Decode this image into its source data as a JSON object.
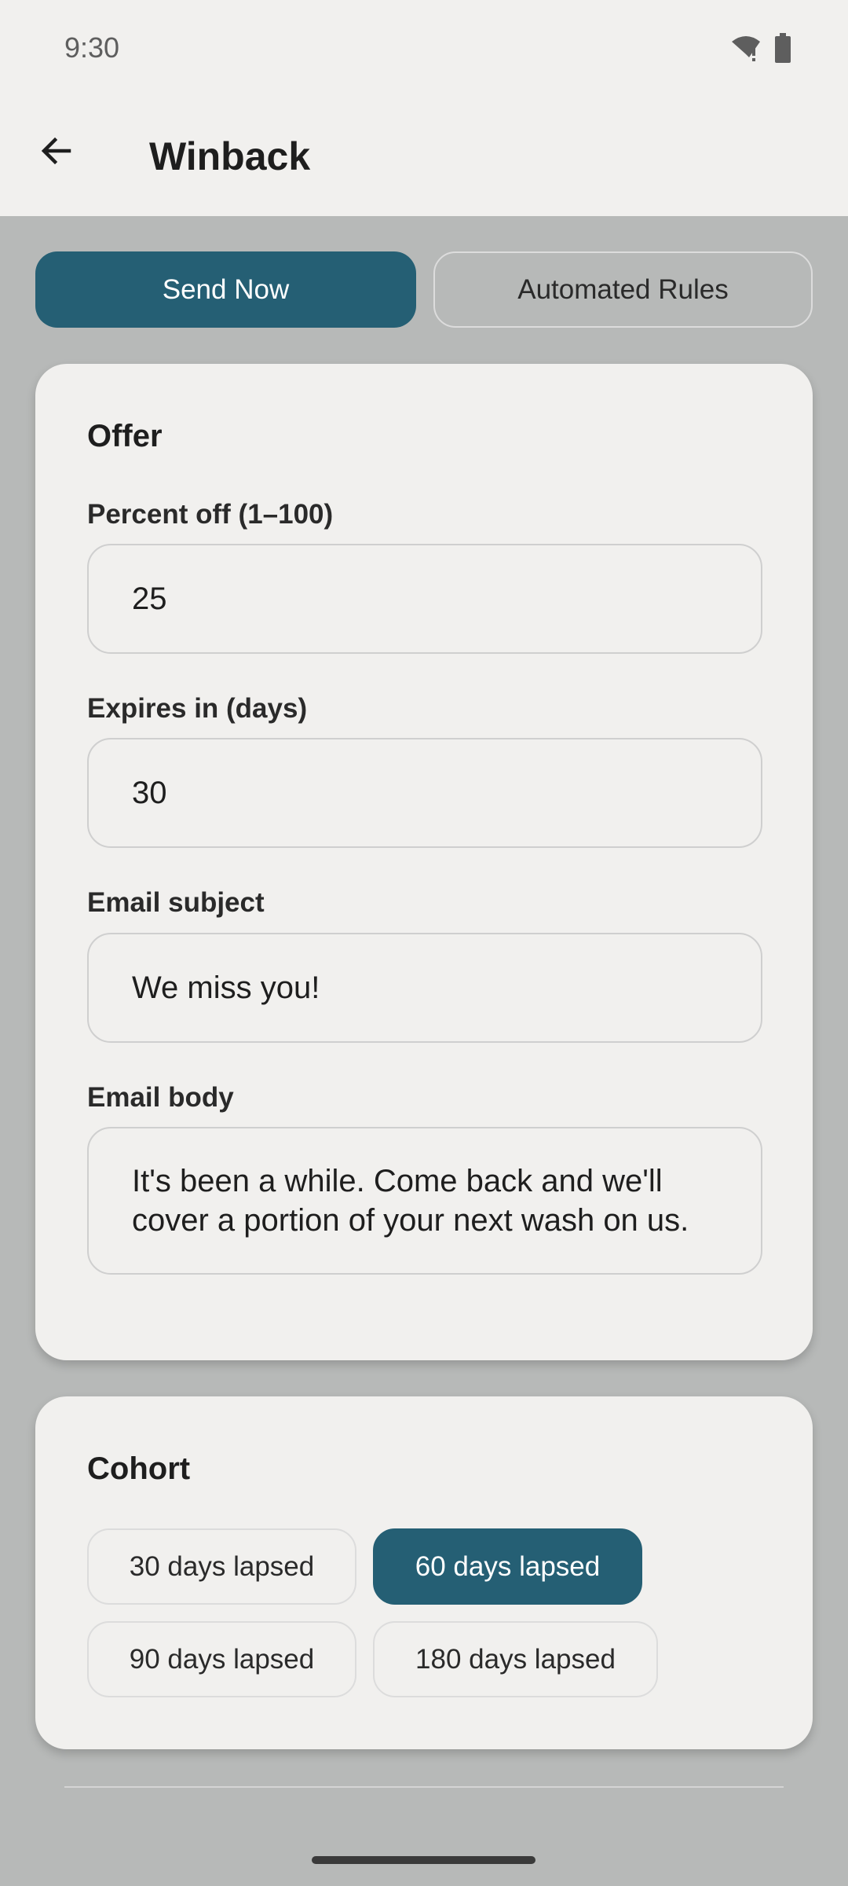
{
  "status_bar": {
    "time": "9:30",
    "icons": [
      "wifi-alert-icon",
      "battery-icon"
    ]
  },
  "app_bar": {
    "back_icon": "arrow-left-icon",
    "title": "Winback"
  },
  "tabs": [
    {
      "label": "Send Now",
      "selected": true
    },
    {
      "label": "Automated Rules",
      "selected": false
    }
  ],
  "offer": {
    "title": "Offer",
    "percent_label": "Percent off (1–100)",
    "percent_value": "25",
    "expires_label": "Expires in (days)",
    "expires_value": "30",
    "subject_label": "Email subject",
    "subject_value": "We miss you!",
    "body_label": "Email body",
    "body_value": "It's been a while. Come back and we'll cover a portion of your next wash on us."
  },
  "cohort": {
    "title": "Cohort",
    "options": [
      {
        "label": "30 days lapsed",
        "selected": false
      },
      {
        "label": "60 days lapsed",
        "selected": true
      },
      {
        "label": "90 days lapsed",
        "selected": false
      },
      {
        "label": "180 days lapsed",
        "selected": false
      }
    ]
  },
  "colors": {
    "accent": "#255f74",
    "background": "#b7b9b8",
    "surface": "#f1f0ee"
  }
}
